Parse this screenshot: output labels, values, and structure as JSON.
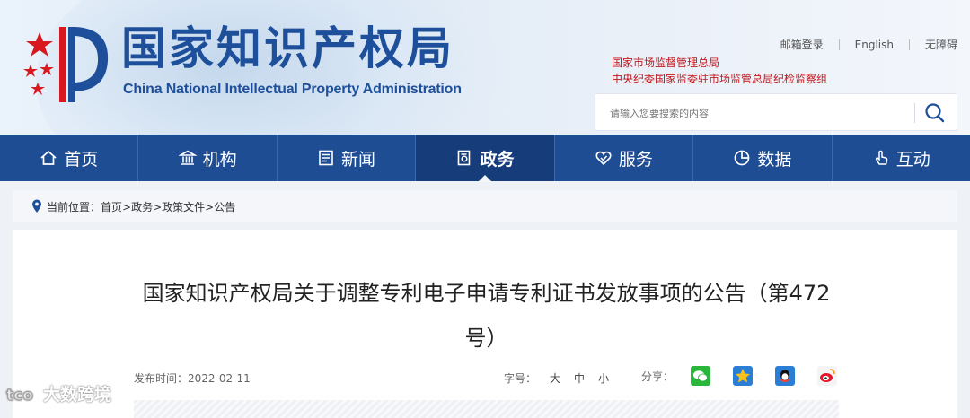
{
  "header": {
    "title_cn": "国家知识产权局",
    "title_en": "China National Intellectual Property Administration",
    "top_links": [
      "邮箱登录",
      "English",
      "无障碍"
    ],
    "orgs": [
      "国家市场监督管理总局",
      "中央纪委国家监委驻市场监管总局纪检监察组"
    ],
    "search": {
      "placeholder": "请输入您要搜索的内容"
    }
  },
  "nav": [
    {
      "label": "首页",
      "icon": "home-icon"
    },
    {
      "label": "机构",
      "icon": "institution-icon"
    },
    {
      "label": "新闻",
      "icon": "news-icon"
    },
    {
      "label": "政务",
      "icon": "government-affairs-icon",
      "active": true
    },
    {
      "label": "服务",
      "icon": "service-icon"
    },
    {
      "label": "数据",
      "icon": "data-chart-icon"
    },
    {
      "label": "互动",
      "icon": "interaction-hand-icon"
    }
  ],
  "breadcrumb": {
    "prefix": "当前位置：",
    "path": "首页>政务>政策文件>公告"
  },
  "article": {
    "title": "国家知识产权局关于调整专利电子申请专利证书发放事项的公告（第472号）",
    "publish_label": "发布时间：",
    "publish_date": "2022-02-11",
    "font_label": "字号：",
    "sizes": [
      "大",
      "中",
      "小"
    ],
    "share_label": "分享："
  },
  "watermark": {
    "text": "大数跨境"
  },
  "colors": {
    "nav_bg": "#1f4d94",
    "nav_active": "#163c7a",
    "brand": "#1e4f9a",
    "org_red": "#c0171c"
  }
}
